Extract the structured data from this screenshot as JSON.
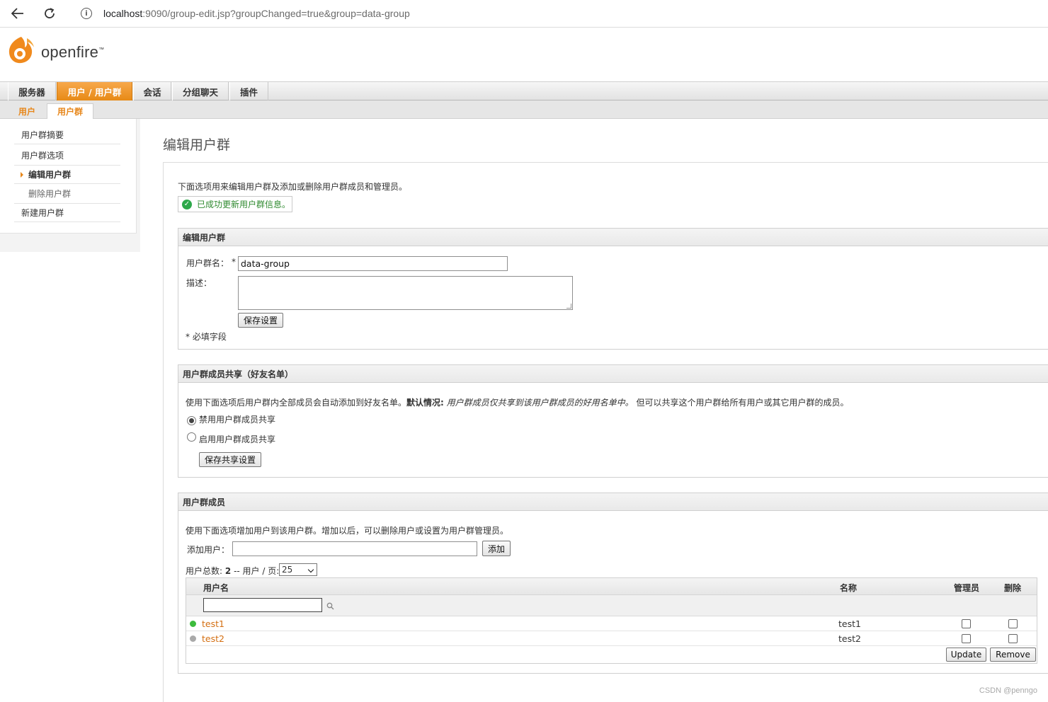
{
  "browser": {
    "url_host": "localhost",
    "url_rest": ":9090/group-edit.jsp?groupChanged=true&group=data-group"
  },
  "app": {
    "name": "openfire"
  },
  "main_tabs": [
    {
      "label": "服务器"
    },
    {
      "label": "用户 / 用户群",
      "active": true
    },
    {
      "label": "会话"
    },
    {
      "label": "分组聊天"
    },
    {
      "label": "插件"
    }
  ],
  "sub_tabs": [
    {
      "label": "用户"
    },
    {
      "label": "用户群",
      "active": true
    }
  ],
  "sidebar": {
    "items": [
      {
        "label": "用户群摘要"
      },
      {
        "label": "用户群选项"
      },
      {
        "label": "编辑用户群",
        "current": true
      },
      {
        "label": "删除用户群"
      },
      {
        "label": "新建用户群"
      }
    ]
  },
  "page": {
    "title": "编辑用户群",
    "intro": "下面选项用来编辑用户群及添加或删除用户群成员和管理员。",
    "success_message": "已成功更新用户群信息。"
  },
  "edit_panel": {
    "header": "编辑用户群",
    "name_label": "用户群名：",
    "required_mark": "*",
    "name_value": "data-group",
    "desc_label": "描述：",
    "save_button": "保存设置",
    "required_note": "* 必填字段"
  },
  "share_panel": {
    "header": "用户群成员共享（好友名单）",
    "desc_plain": "使用下面选项后用户群内全部成员会自动添加到好友名单。",
    "desc_bold": "默认情况:",
    "desc_italic": "用户群成员仅共享到该用户群成员的好用名单中。",
    "desc_tail": "但可以共享这个用户群给所有用户或其它用户群的成员。",
    "option_disable": "禁用用户群成员共享",
    "option_enable": "启用用户群成员共享",
    "save_button": "保存共享设置"
  },
  "members_panel": {
    "header": "用户群成员",
    "desc": "使用下面选项增加用户到该用户群。增加以后，可以删除用户或设置为用户群管理员。",
    "add_label": "添加用户：",
    "add_button": "添加",
    "total_prefix": "用户总数:",
    "total_count": "2",
    "per_page_label": "-- 用户 / 页:",
    "per_page_value": "25",
    "columns": {
      "username": "用户名",
      "name": "名称",
      "admin": "管理员",
      "delete": "删除"
    },
    "rows": [
      {
        "username": "test1",
        "name": "test1",
        "online": true
      },
      {
        "username": "test2",
        "name": "test2",
        "online": false
      }
    ],
    "update_button": "Update",
    "remove_button": "Remove"
  },
  "colors": {
    "accent": "#e7871b",
    "online": "#3cbb3c",
    "offline": "#a9a9a9",
    "success": "#2f8a2f"
  },
  "watermark": "CSDN @penngo"
}
